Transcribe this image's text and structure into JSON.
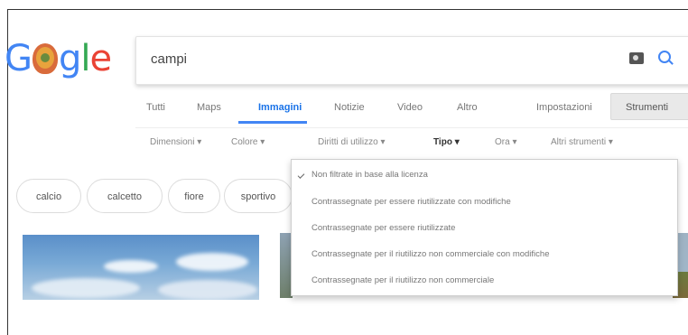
{
  "logo": {
    "text": [
      "G",
      "g",
      "l",
      "e"
    ]
  },
  "search": {
    "query": "campi"
  },
  "tabs": [
    {
      "label": "Tutti"
    },
    {
      "label": "Maps"
    },
    {
      "label": "Immagini",
      "active": true
    },
    {
      "label": "Notizie"
    },
    {
      "label": "Video"
    },
    {
      "label": "Altro"
    }
  ],
  "settings_label": "Impostazioni",
  "tools_label": "Strumenti",
  "filters": [
    {
      "label": "Dimensioni ▾"
    },
    {
      "label": "Colore ▾"
    },
    {
      "label": "Diritti di utilizzo ▾"
    },
    {
      "label": "Tipo ▾"
    },
    {
      "label": "Ora ▾"
    },
    {
      "label": "Altri strumenti ▾"
    }
  ],
  "chips": [
    {
      "label": "calcio"
    },
    {
      "label": "calcetto"
    },
    {
      "label": "fiore"
    },
    {
      "label": "sportivo"
    }
  ],
  "usage_rights_menu": {
    "items": [
      {
        "label": "Non filtrate in base alla licenza",
        "selected": true
      },
      {
        "label": "Contrassegnate per essere riutilizzate con modifiche"
      },
      {
        "label": "Contrassegnate per essere riutilizzate"
      },
      {
        "label": "Contrassegnate per il riutilizzo non commerciale con modifiche"
      },
      {
        "label": "Contrassegnate per il riutilizzo non commerciale"
      }
    ]
  },
  "colors": {
    "google_blue": "#4285f4",
    "tools_bg": "#e9e9e9"
  },
  "icons": [
    "camera-icon",
    "search-icon",
    "check-icon"
  ]
}
